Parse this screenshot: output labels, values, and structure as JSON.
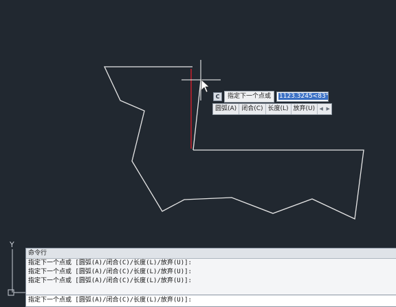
{
  "drawing": {
    "polyline_color": "#e6e6e6",
    "rubber_band_color": "#c8202a",
    "crosshair_color": "#ffffff",
    "background": "#212830"
  },
  "ucs": {
    "y_label": "Y"
  },
  "dynamic_input": {
    "icon": "C",
    "prompt": "指定下一个点或",
    "value": "1123.3245<83°",
    "options": [
      "圆弧(A)",
      "闭合(C)",
      "长度(L)",
      "放弃(U)"
    ]
  },
  "command_line": {
    "title": "命令行",
    "history": [
      "指定下一个点或 [圆弧(A)/闭合(C)/长度(L)/放弃(U)]:",
      "指定下一个点或 [圆弧(A)/闭合(C)/长度(L)/放弃(U)]:",
      "指定下一个点或 [圆弧(A)/闭合(C)/长度(L)/放弃(U)]:"
    ],
    "input": "指定下一个点或 [圆弧(A)/闭合(C)/长度(L)/放弃(U)]:"
  }
}
